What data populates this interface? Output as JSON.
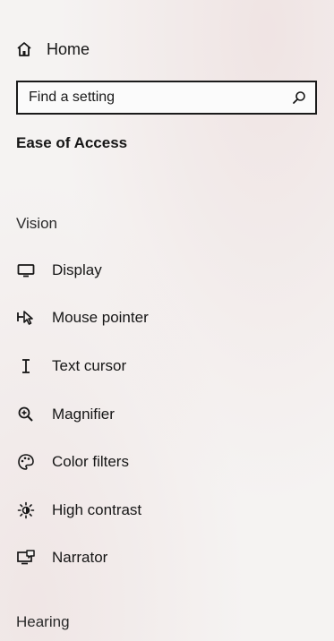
{
  "home": {
    "label": "Home",
    "icon": "home-icon"
  },
  "search": {
    "placeholder": "Find a setting",
    "icon": "search-icon"
  },
  "section": {
    "title": "Ease of Access"
  },
  "groups": {
    "vision": "Vision",
    "hearing": "Hearing"
  },
  "nav": {
    "display": {
      "label": "Display",
      "icon": "display-icon"
    },
    "mouse_pointer": {
      "label": "Mouse pointer",
      "icon": "mouse-pointer-icon"
    },
    "text_cursor": {
      "label": "Text cursor",
      "icon": "text-cursor-icon"
    },
    "magnifier": {
      "label": "Magnifier",
      "icon": "magnifier-icon"
    },
    "color_filters": {
      "label": "Color filters",
      "icon": "color-filters-icon"
    },
    "high_contrast": {
      "label": "High contrast",
      "icon": "high-contrast-icon"
    },
    "narrator": {
      "label": "Narrator",
      "icon": "narrator-icon"
    }
  }
}
